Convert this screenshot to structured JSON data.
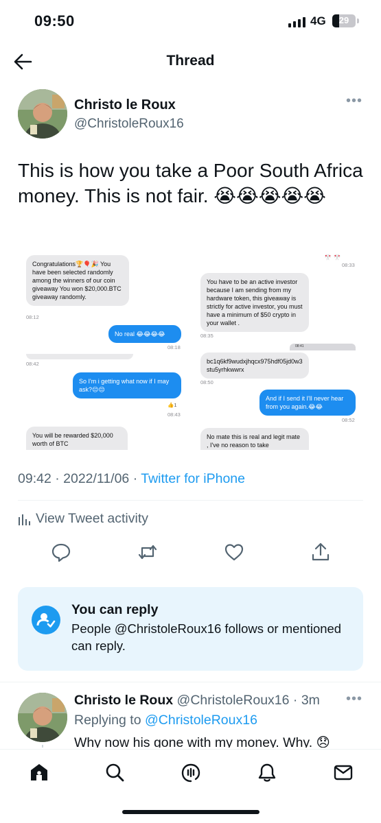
{
  "status_bar": {
    "time": "09:50",
    "network": "4G",
    "battery": "29",
    "battery_level": 0.29
  },
  "header": {
    "title": "Thread"
  },
  "tweet": {
    "author_name": "Christo le Roux",
    "author_handle": "@ChristoleRoux16",
    "text": "This is how you take a Poor South Africa money. This is not fair. 😭😭😭😭😭",
    "timestamp": "09:42 · 2022/11/06 · ",
    "source": "Twitter for iPhone",
    "activity_label": "View Tweet activity"
  },
  "media": {
    "left": {
      "msg1": "Congratulations🏆🎈🎉 You have been  selected randomly among the winners of our coin giveaway You won $20,000.BTC giveaway randomly.",
      "t1": "08:12",
      "msg2": "No real 😂😂😂😂",
      "t2": "08:18",
      "t3": "08:42",
      "msg3": "So I'm i getting what now if I may ask?😔😔",
      "react": "👍1",
      "t4": "08:43",
      "msg4": "You will be rewarded $20,000 worth of BTC"
    },
    "right": {
      "flags": "🎌 🎌",
      "t1": "08:33",
      "msg1": "You have to be an active investor because I am sending from my hardware token, this giveaway is strictly for active investor, you must have a minimum of $50 crypto in your wallet .",
      "t2": "08:35",
      "mini_time": "08:41",
      "msg2": "bc1q6kf9wudxjhqcx975hdf05jd0w3stu5yrhkwwrx",
      "t3": "08:50",
      "msg3": "And if I send it I'll never hear from you again.😂😂",
      "t4": "08:52",
      "msg4": "No mate this is real and legit mate , I've no reason to take"
    }
  },
  "reply_permission": {
    "title": "You can reply",
    "description": "People @ChristoleRoux16 follows or mentioned can reply."
  },
  "reply_tweet": {
    "author_name": "Christo le Roux",
    "author_handle": "@ChristoleRoux16",
    "age": " · 3m",
    "replying_prefix": "Replying to ",
    "replying_to": "@ChristoleRoux16",
    "text": "Why now his gone with my money. Why. 😞"
  },
  "icons": {
    "back": "arrow-left-icon",
    "reply": "reply-icon",
    "retweet": "retweet-icon",
    "like": "heart-icon",
    "share": "share-icon",
    "tabs": [
      "home-icon",
      "search-icon",
      "spaces-icon",
      "notifications-icon",
      "messages-icon"
    ]
  },
  "colors": {
    "accent": "#1d9bf0",
    "secondary_text": "#536471",
    "reply_box_bg": "#e8f5fd",
    "bubble_blue": "#1d8df0"
  }
}
